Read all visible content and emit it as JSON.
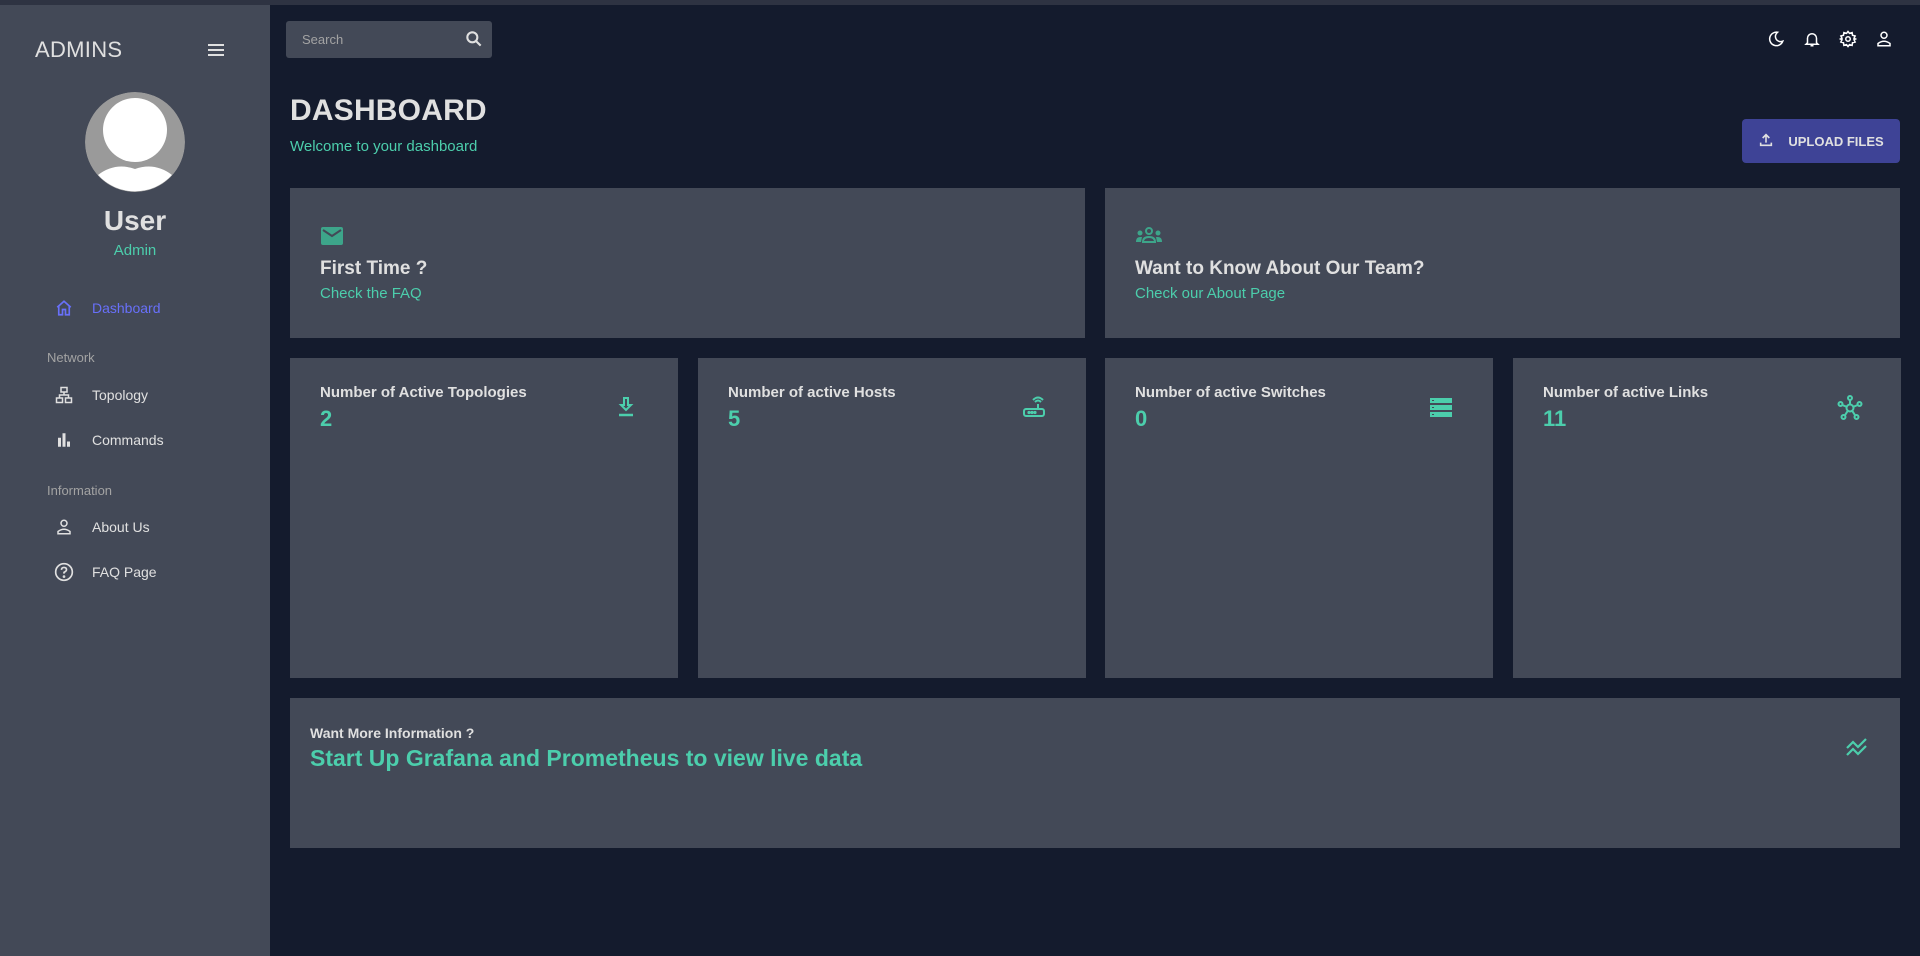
{
  "sidebar": {
    "brand": "ADMINS",
    "user": {
      "name": "User",
      "role": "Admin"
    },
    "items": [
      {
        "label": "Dashboard",
        "icon": "home-icon",
        "active": true
      },
      {
        "label": "Topology",
        "icon": "sitemap-icon",
        "section": "Network"
      },
      {
        "label": "Commands",
        "icon": "bar-chart-icon",
        "section": "Network"
      },
      {
        "label": "About Us",
        "icon": "person-icon",
        "section": "Information"
      },
      {
        "label": "FAQ Page",
        "icon": "help-circle-icon",
        "section": "Information"
      }
    ],
    "sections": [
      "Network",
      "Information"
    ]
  },
  "topbar": {
    "search_placeholder": "Search",
    "icons": [
      "dark-mode-icon",
      "notifications-icon",
      "settings-icon",
      "profile-icon"
    ]
  },
  "header": {
    "title": "DASHBOARD",
    "subtitle": "Welcome to your dashboard",
    "upload_label": "UPLOAD FILES"
  },
  "info_cards": [
    {
      "title": "First Time ?",
      "link": "Check the FAQ",
      "icon": "email-icon"
    },
    {
      "title": "Want to Know About Our Team?",
      "link": "Check our About Page",
      "icon": "groups-icon"
    }
  ],
  "stats": [
    {
      "label": "Number of Active Topologies",
      "value": "2",
      "icon": "download-icon"
    },
    {
      "label": "Number of active Hosts",
      "value": "5",
      "icon": "router-icon"
    },
    {
      "label": "Number of active Switches",
      "value": "0",
      "icon": "storage-icon"
    },
    {
      "label": "Number of active Links",
      "value": "11",
      "icon": "hub-icon"
    }
  ],
  "bottom_card": {
    "label": "Want More Information ?",
    "text": "Start Up Grafana and Prometheus to view live data",
    "icon": "stacked-line-chart-icon"
  },
  "colors": {
    "accent_green": "#4cceac",
    "accent_blue": "#6870fa",
    "button": "#3e4396",
    "background": "#141b2d",
    "panel": "#434957"
  }
}
